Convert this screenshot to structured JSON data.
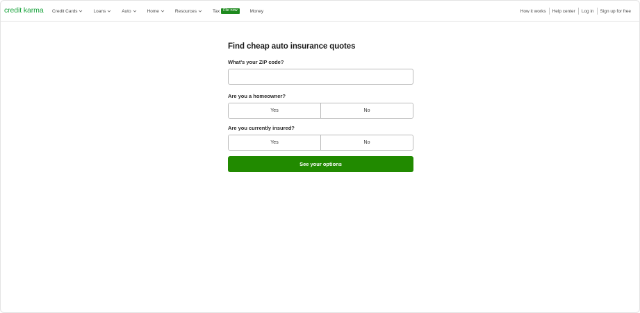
{
  "brand": {
    "logo": "credit karma",
    "accent": "#1aa33d",
    "cta_color": "#218a00"
  },
  "nav": {
    "items": [
      {
        "label": "Credit Cards",
        "icon": "chevron-down-icon"
      },
      {
        "label": "Loans",
        "icon": "chevron-down-icon"
      },
      {
        "label": "Auto",
        "icon": "chevron-down-icon"
      },
      {
        "label": "Home",
        "icon": "chevron-down-icon"
      },
      {
        "label": "Resources",
        "icon": "chevron-down-icon"
      }
    ],
    "tax": {
      "label": "Tax",
      "badge": "File now"
    },
    "money": "Money",
    "right": [
      "How it works",
      "Help center",
      "Log in",
      "Sign up for free"
    ]
  },
  "form": {
    "title": "Find cheap auto insurance quotes",
    "zip_label": "What's your ZIP code?",
    "zip_value": "",
    "homeowner_label": "Are you a homeowner?",
    "homeowner_options": [
      "Yes",
      "No"
    ],
    "insured_label": "Are you currently insured?",
    "insured_options": [
      "Yes",
      "No"
    ],
    "submit": "See your options"
  }
}
